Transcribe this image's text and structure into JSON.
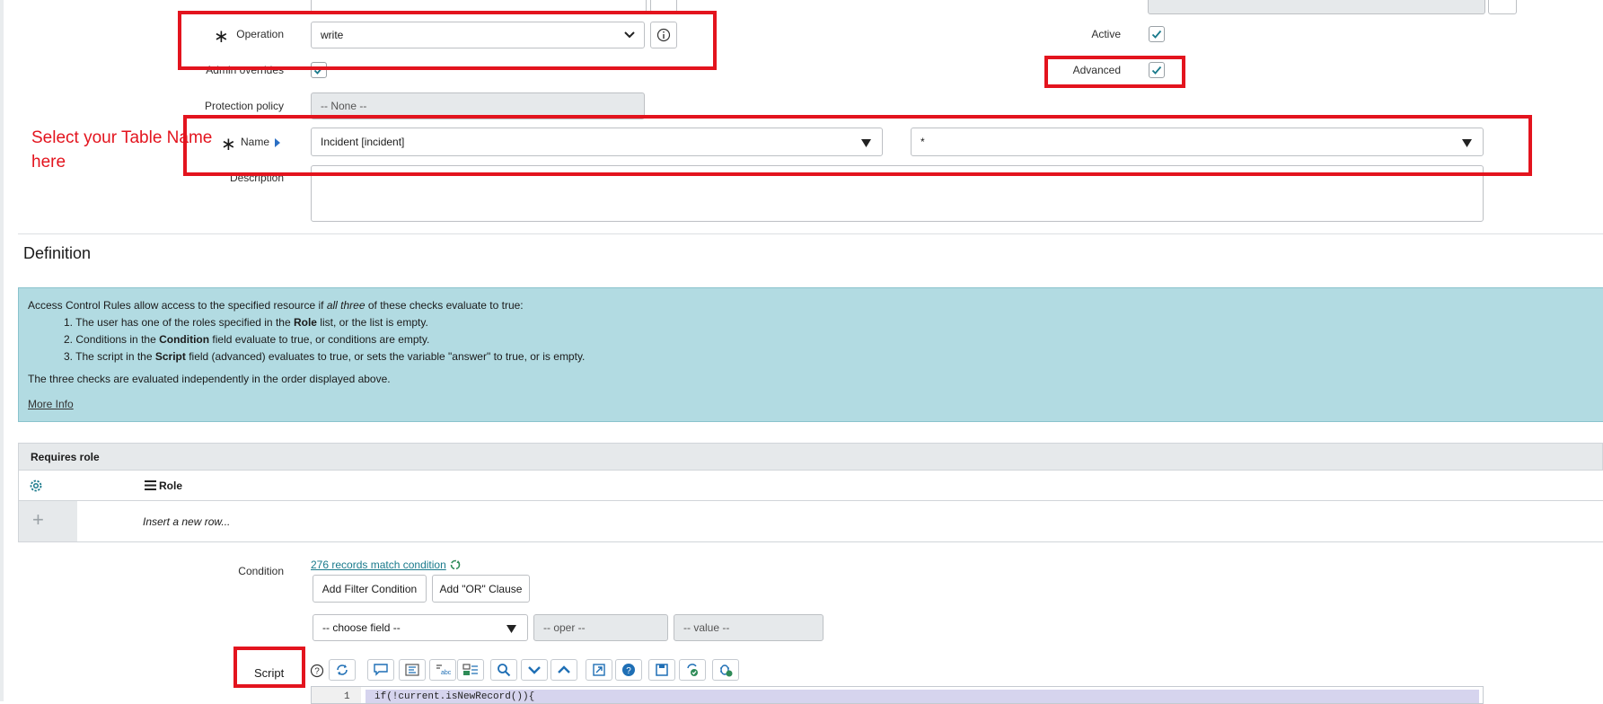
{
  "form": {
    "operation": {
      "label": "Operation",
      "value": "write"
    },
    "active": {
      "label": "Active"
    },
    "admin_overrides": {
      "label": "Admin overrides"
    },
    "advanced": {
      "label": "Advanced"
    },
    "protection_policy": {
      "label": "Protection policy",
      "value": "-- None --"
    },
    "name": {
      "label": "Name",
      "table_value": "Incident [incident]",
      "field_value": "*"
    },
    "description": {
      "label": "Description",
      "value": ""
    }
  },
  "annotation": {
    "line1": "Select your Table Name",
    "line2": "here"
  },
  "definition": {
    "title": "Definition",
    "intro_a": "Access Control Rules allow access to the specified resource if ",
    "intro_em": "all three",
    "intro_b": " of these checks evaluate to true:",
    "items": [
      {
        "num": "1.",
        "a": "The user has one of the roles specified in the ",
        "b": "Role",
        "c": " list, or the list is empty."
      },
      {
        "num": "2.",
        "a": "Conditions in the ",
        "b": "Condition",
        "c": " field evaluate to true, or conditions are empty."
      },
      {
        "num": "3.",
        "a": "The script in the ",
        "b": "Script",
        "c": " field (advanced) evaluates to true, or sets the variable \"answer\" to true, or is empty."
      }
    ],
    "note": "The three checks are evaluated independently in the order displayed above.",
    "more_info": "More Info"
  },
  "requires_role": {
    "title": "Requires role",
    "column": "Role",
    "insert_row": "Insert a new row..."
  },
  "condition": {
    "label": "Condition",
    "records_link": "276 records match condition",
    "add_filter": "Add Filter Condition",
    "add_or": "Add \"OR\" Clause",
    "choose_field": "-- choose field --",
    "oper": "-- oper --",
    "value": "-- value --"
  },
  "script": {
    "label": "Script",
    "line_number": "1",
    "code": "if(!current.isNewRecord()){"
  },
  "colors": {
    "accent": "#e3141e",
    "teal": "#1a7a8c",
    "info_bg": "#b2dbe2",
    "toolbar_icon": "#1f6fb5"
  }
}
